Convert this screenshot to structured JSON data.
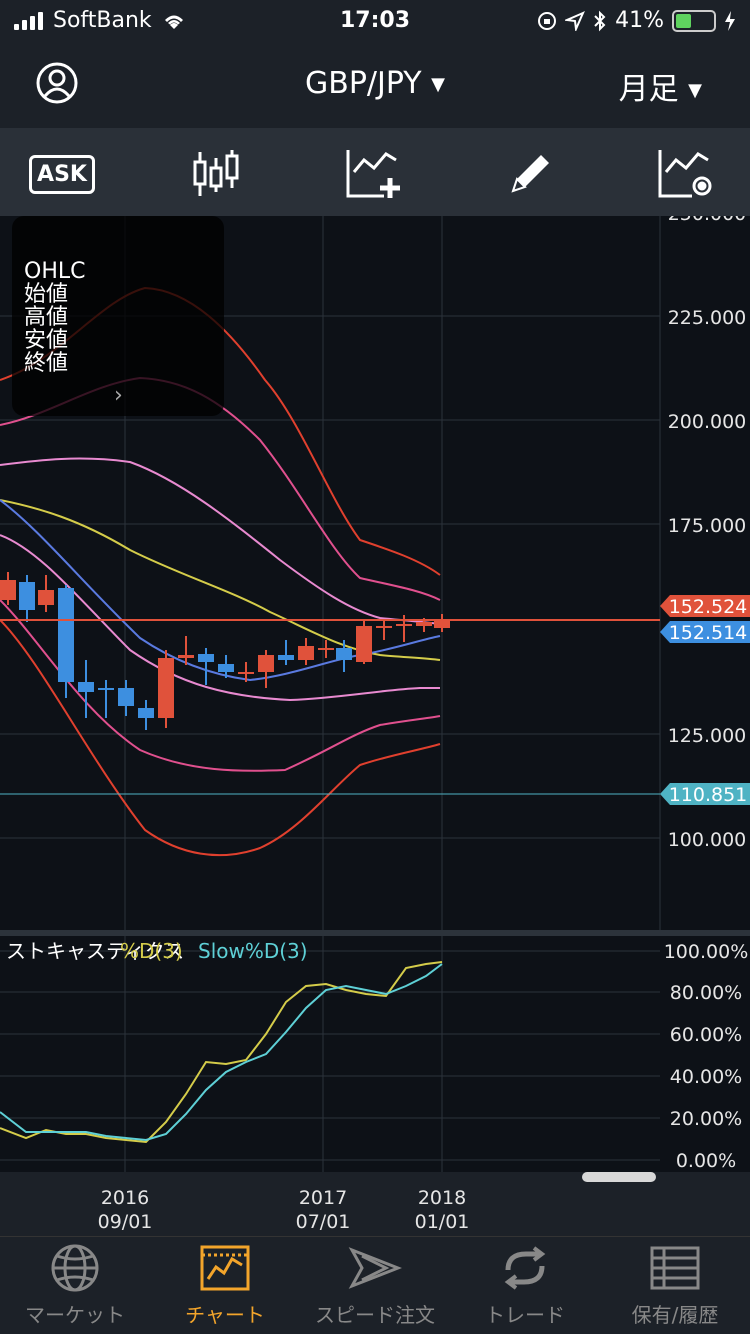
{
  "status": {
    "carrier": "SoftBank",
    "time": "17:03",
    "battery": "41%",
    "battery_level": 0.41
  },
  "header": {
    "pair": "GBP/JPY",
    "period": "月足"
  },
  "toolbar": {
    "ask_label": "ASK"
  },
  "ohlc_panel": {
    "lines": [
      "OHLC",
      "始値",
      "高値",
      "安値",
      "終値"
    ]
  },
  "main_chart": {
    "y_labels": [
      "250.000",
      "225.000",
      "200.000",
      "175.000",
      "125.000",
      "100.000"
    ],
    "price_tags": [
      {
        "value": "152.524",
        "color": "#e0523b"
      },
      {
        "value": "152.514",
        "color": "#3d8fe0"
      },
      {
        "value": "110.851",
        "color": "#4fb3c4"
      }
    ]
  },
  "indicator": {
    "name": "ストキャスティクス",
    "series1": "%D(3)",
    "series2": "Slow%D(3)",
    "y_labels": [
      "100.00%",
      "80.00%",
      "60.00%",
      "40.00%",
      "20.00%",
      "0.00%"
    ]
  },
  "x_axis": [
    {
      "year": "2016",
      "date": "09/01"
    },
    {
      "year": "2017",
      "date": "07/01"
    },
    {
      "year": "2018",
      "date": "01/01"
    }
  ],
  "tabs": [
    {
      "label": "マーケット",
      "icon": "globe-icon"
    },
    {
      "label": "チャート",
      "icon": "chart-icon"
    },
    {
      "label": "スピード注文",
      "icon": "speed-order-icon"
    },
    {
      "label": "トレード",
      "icon": "trade-icon"
    },
    {
      "label": "保有/履歴",
      "icon": "list-icon"
    }
  ],
  "colors": {
    "accent": "#f3a52b",
    "bull_candle": "#e0523b",
    "bear_candle": "#3d8fe0",
    "stoch_d": "#d4cc4a",
    "stoch_slow": "#5ed0d6"
  }
}
